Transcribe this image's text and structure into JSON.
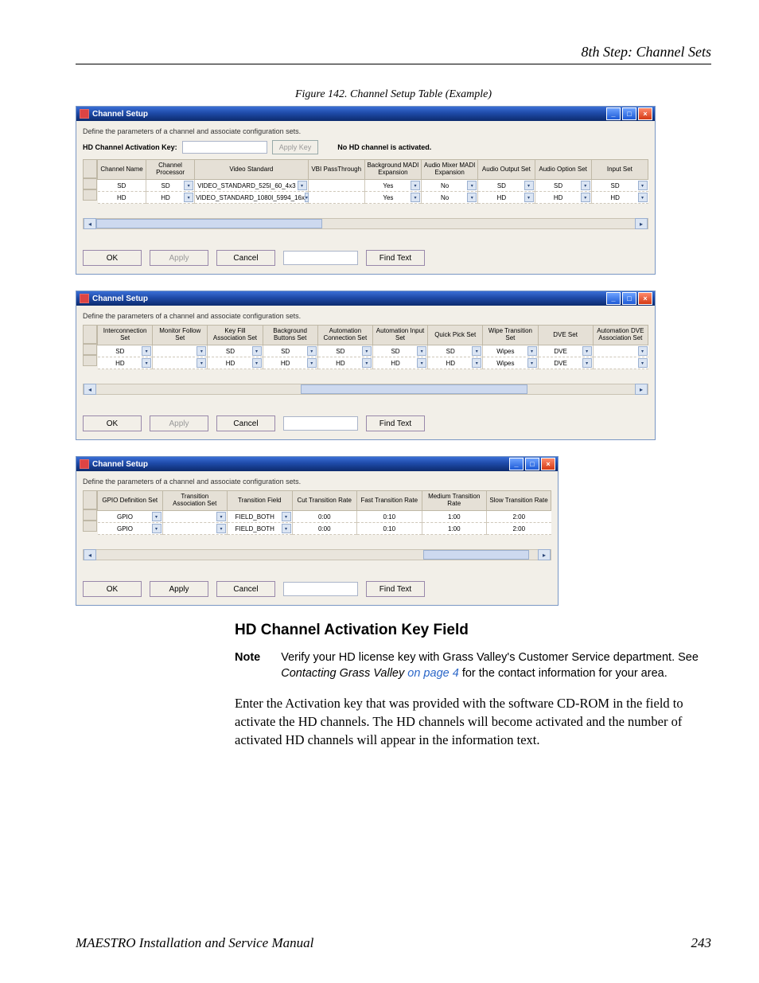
{
  "header": {
    "section": "8th Step: Channel Sets"
  },
  "figure": {
    "caption": "Figure 142.  Channel Setup Table (Example)"
  },
  "win_common": {
    "title": "Channel Setup",
    "desc": "Define the parameters of a channel and associate configuration sets.",
    "ok": "OK",
    "apply": "Apply",
    "cancel": "Cancel",
    "find": "Find Text"
  },
  "win1": {
    "hd_label": "HD Channel Activation Key:",
    "apply_key": "Apply Key",
    "hd_info": "No HD channel is activated.",
    "headers": [
      "Channel Name",
      "Channel Processor",
      "Video Standard",
      "VBI PassThrough",
      "Background MADI Expansion",
      "Audio Mixer MADI Expansion",
      "Audio Output Set",
      "Audio Option Set",
      "Input Set"
    ],
    "rows": [
      {
        "name": "SD",
        "proc": "SD",
        "std": "VIDEO_STANDARD_525I_60_4x3",
        "vbi": "",
        "bg": "Yes",
        "am": "No",
        "ao": "SD",
        "aopt": "SD",
        "inp": "SD"
      },
      {
        "name": "HD",
        "proc": "HD",
        "std": "VIDEO_STANDARD_1080I_5994_16x",
        "vbi": "",
        "bg": "Yes",
        "am": "No",
        "ao": "HD",
        "aopt": "HD",
        "inp": "HD"
      }
    ]
  },
  "win2": {
    "headers": [
      "Interconnection Set",
      "Monitor Follow Set",
      "Key Fill Association Set",
      "Background Buttons Set",
      "Automation Connection Set",
      "Automation Input Set",
      "Quick Pick Set",
      "Wipe Transition Set",
      "DVE Set",
      "Automation DVE Association Set"
    ],
    "rows": [
      {
        "c0": "SD",
        "c1": "",
        "c2": "SD",
        "c3": "SD",
        "c4": "SD",
        "c5": "SD",
        "c6": "SD",
        "c7": "Wipes",
        "c8": "DVE",
        "c9": ""
      },
      {
        "c0": "HD",
        "c1": "",
        "c2": "HD",
        "c3": "HD",
        "c4": "HD",
        "c5": "HD",
        "c6": "HD",
        "c7": "Wipes",
        "c8": "DVE",
        "c9": ""
      }
    ]
  },
  "win3": {
    "headers": [
      "GPIO Definition Set",
      "Transition Association Set",
      "Transition Field",
      "Cut Transition Rate",
      "Fast Transition Rate",
      "Medium Transition Rate",
      "Slow Transition Rate"
    ],
    "rows": [
      {
        "c0": "GPIO",
        "c1": "",
        "c2": "FIELD_BOTH",
        "c3": "0:00",
        "c4": "0:10",
        "c5": "1:00",
        "c6": "2:00"
      },
      {
        "c0": "GPIO",
        "c1": "",
        "c2": "FIELD_BOTH",
        "c3": "0:00",
        "c4": "0:10",
        "c5": "1:00",
        "c6": "2:00"
      }
    ]
  },
  "section": {
    "heading": "HD Channel Activation Key Field",
    "note_label": "Note",
    "note_text_1": "Verify your HD license key with Grass Valley's Customer Service department. See ",
    "note_text_ital": "Contacting Grass Valley",
    "note_link": " on page 4",
    "note_text_2": " for the contact information for your area.",
    "para": "Enter the Activation key that was provided with the software CD-ROM in the field to activate the HD channels. The HD channels will become activated and the number of activated HD channels will appear in the information text."
  },
  "footer": {
    "left": "MAESTRO Installation and Service Manual",
    "right": "243"
  }
}
